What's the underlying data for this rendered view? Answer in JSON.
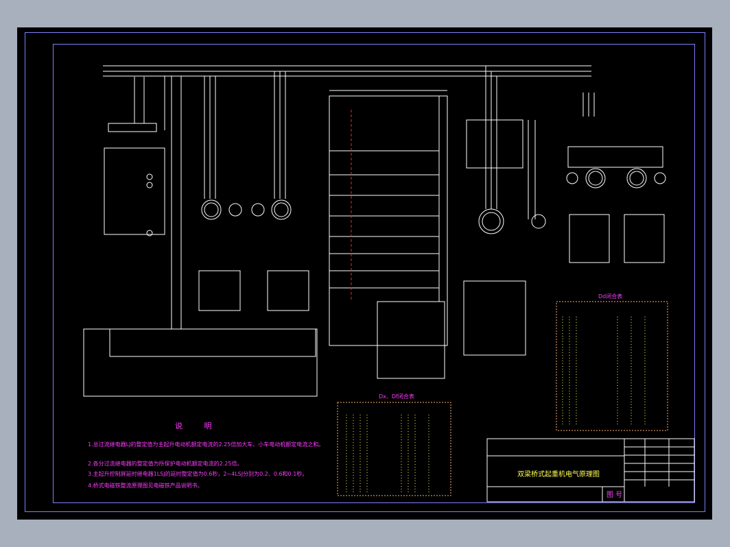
{
  "drawing": {
    "title": "双梁桥式起重机电气原理图",
    "drawing_no_label": "图  号"
  },
  "notes": {
    "heading": "说    明",
    "items": [
      "1.总过流继电器LJ的整定值为主起升电动机额定电流的2.25倍加大车、小车电动机额定电流之和。",
      "2.各分过流继电器的整定值为所保护电动机额定电流的2.25倍。",
      "3.主起升控制屏延时继电器1LSJ的延时整定值为0.6秒，2~4LSJ分别为0.2、0.6和0.1秒。",
      "4.桥式电磁铁整流原理图见电磁铁产品说明书。"
    ]
  },
  "tables": {
    "dx_xf": "Dx、Df闭合表",
    "dd": "Dd闭合表"
  },
  "colors": {
    "wire": "#ffffff",
    "label": "#ff3cff",
    "frame": "#7f7fff",
    "accent_yellow": "#ffff55",
    "accent_red": "#ff2020"
  }
}
